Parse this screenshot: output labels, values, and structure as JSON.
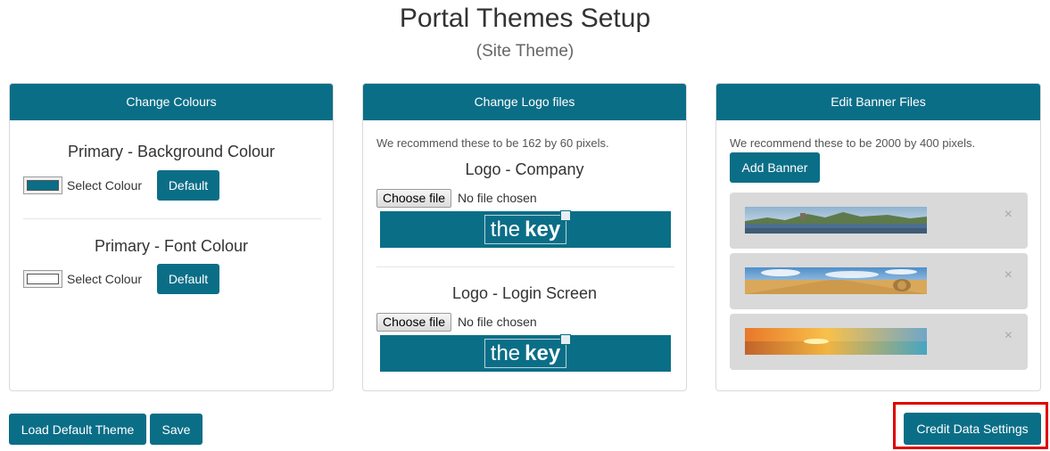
{
  "header": {
    "title": "Portal Themes Setup",
    "subtitle": "(Site Theme)"
  },
  "colours_panel": {
    "heading": "Change Colours",
    "sections": [
      {
        "title": "Primary - Background Colour",
        "select_label": "Select Colour",
        "default_label": "Default",
        "swatch_color": "#0b6e87"
      },
      {
        "title": "Primary - Font Colour",
        "select_label": "Select Colour",
        "default_label": "Default",
        "swatch_color": "#ffffff"
      }
    ]
  },
  "logo_panel": {
    "heading": "Change Logo files",
    "note": "We recommend these to be 162 by 60 pixels.",
    "sections": [
      {
        "title": "Logo - Company",
        "choose_label": "Choose file",
        "status": "No file chosen",
        "logo": {
          "the": "the",
          "key": "key"
        }
      },
      {
        "title": "Logo - Login Screen",
        "choose_label": "Choose file",
        "status": "No file chosen",
        "logo": {
          "the": "the",
          "key": "key"
        }
      }
    ]
  },
  "banner_panel": {
    "heading": "Edit Banner Files",
    "note": "We recommend these to be 2000 by 400 pixels.",
    "add_label": "Add Banner",
    "banners": [
      {
        "image": "lake-castle-panorama",
        "remove": "×"
      },
      {
        "image": "hay-field-panorama",
        "remove": "×"
      },
      {
        "image": "sunset-sea-panorama",
        "remove": "×"
      }
    ]
  },
  "footer": {
    "load_default_label": "Load Default Theme",
    "save_label": "Save",
    "credit_label": "Credit Data Settings"
  },
  "colors": {
    "accent": "#0b6e87",
    "highlight": "#e00000"
  }
}
